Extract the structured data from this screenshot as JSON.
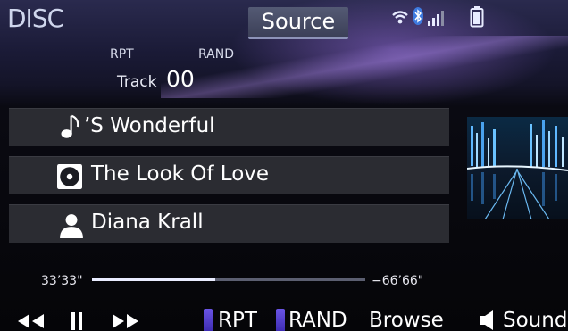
{
  "header": {
    "title": "DISC",
    "source_label": "Source",
    "status_icons": [
      "wifi-icon",
      "bluetooth-icon",
      "signal-strength-icon",
      "battery-icon"
    ]
  },
  "indicators": {
    "rpt": "RPT",
    "rand": "RAND"
  },
  "track": {
    "label": "Track",
    "number": "00"
  },
  "info": {
    "song": "’S Wonderful",
    "album": "The Look Of Love",
    "artist": "Diana Krall"
  },
  "progress": {
    "elapsed": "33’33\"",
    "remaining": "−66’66\"",
    "fraction": 0.45
  },
  "controls": {
    "rewind_icon": "rewind-icon",
    "pause_icon": "pause-icon",
    "fastforward_icon": "fast-forward-icon",
    "rpt": "RPT",
    "rand": "RAND",
    "browse": "Browse",
    "sound": "Sound"
  },
  "colors": {
    "accent_indicator": "#5a46d8",
    "row_bg": "#2b2c32",
    "header_bg": "#24243f"
  }
}
